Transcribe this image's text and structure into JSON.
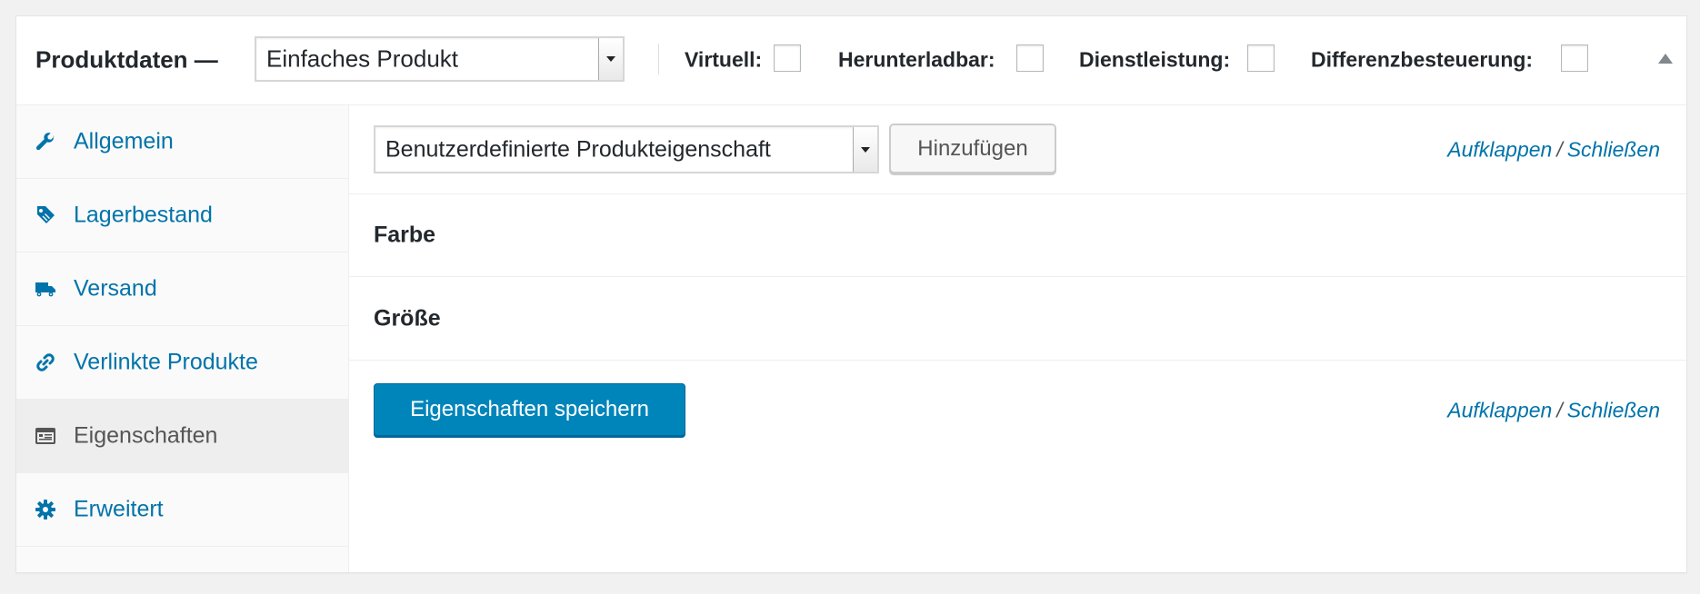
{
  "header": {
    "title": "Produktdaten —",
    "product_type": "Einfaches Produkt",
    "options": [
      {
        "label": "Virtuell:",
        "checked": false
      },
      {
        "label": "Herunterladbar:",
        "checked": false
      },
      {
        "label": "Dienstleistung:",
        "checked": false
      },
      {
        "label": "Differenzbesteuerung:",
        "checked": false
      }
    ],
    "toggle_icon": "triangle-up-icon"
  },
  "sidebar": {
    "items": [
      {
        "label": "Allgemein",
        "icon": "wrench-icon",
        "active": false
      },
      {
        "label": "Lagerbestand",
        "icon": "tag-icon",
        "active": false
      },
      {
        "label": "Versand",
        "icon": "truck-icon",
        "active": false
      },
      {
        "label": "Verlinkte Produkte",
        "icon": "link-icon",
        "active": false
      },
      {
        "label": "Eigenschaften",
        "icon": "attributes-icon",
        "active": true
      },
      {
        "label": "Erweitert",
        "icon": "gear-icon",
        "active": false
      }
    ]
  },
  "main": {
    "attribute_select": "Benutzerdefinierte Produkteigenschaft",
    "add_button": "Hinzufügen",
    "expand": "Aufklappen",
    "separator": "/",
    "close": "Schließen",
    "attributes": [
      {
        "name": "Farbe"
      },
      {
        "name": "Größe"
      }
    ],
    "save_button": "Eigenschaften speichern"
  },
  "colors": {
    "link": "#0073aa",
    "primary_button": "#0085ba",
    "active_tab_bg": "#eeeeee"
  }
}
